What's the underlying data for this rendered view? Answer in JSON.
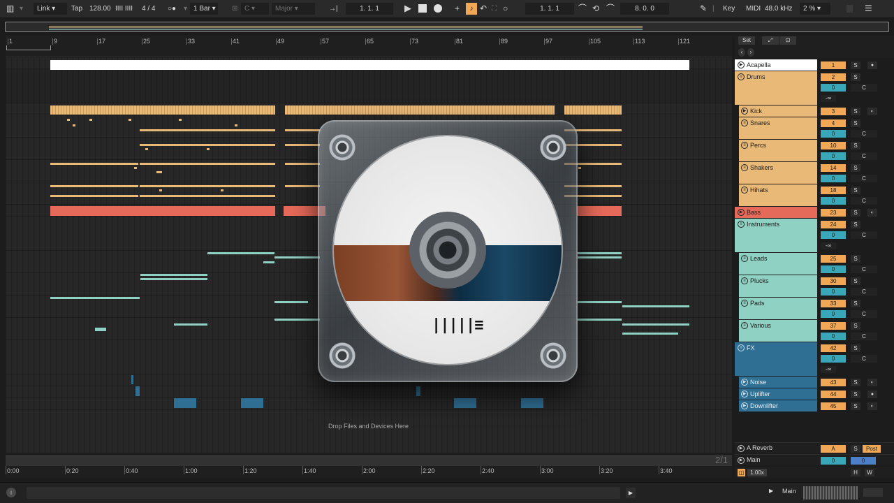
{
  "transport": {
    "link_label": "Link",
    "tap_label": "Tap",
    "tempo": "128.00",
    "meter_icon": "IIII IIII",
    "time_signature": "4 / 4",
    "metronome": "○●",
    "quantize": "1 Bar",
    "key_root": "C",
    "scale": "Major",
    "position": "1.   1.   1",
    "loop_start": "1.   1.   1",
    "loop_length": "8.   0.   0",
    "key_label": "Key",
    "midi_label": "MIDI",
    "sample_rate": "48.0 kHz",
    "cpu": "2 %"
  },
  "ruler": {
    "bars": [
      "1",
      "9",
      "17",
      "25",
      "33",
      "41",
      "49",
      "57",
      "65",
      "73",
      "81",
      "89",
      "97",
      "105",
      "113",
      "121"
    ]
  },
  "time_ruler": {
    "times": [
      "0:00",
      "0:20",
      "0:40",
      "1:00",
      "1:20",
      "1:40",
      "2:00",
      "2:20",
      "2:40",
      "3:00",
      "3:20",
      "3:40"
    ],
    "bars_ratio": "2/1"
  },
  "arrangement": {
    "drop_text": "Drop Files and Devices Here"
  },
  "mixer_top": {
    "set_label": "Set",
    "expand_icon": "⤢",
    "lock_icon": "🔒"
  },
  "tracks": [
    {
      "name": "Acapella",
      "num": "1"
    },
    {
      "name": "Drums",
      "num": "2",
      "vol": "0",
      "pan": "C",
      "send": "-∞"
    },
    {
      "name": "Kick",
      "num": "3"
    },
    {
      "name": "Snares",
      "num": "4",
      "vol": "0",
      "pan": "C"
    },
    {
      "name": "Percs",
      "num": "10",
      "vol": "0",
      "pan": "C"
    },
    {
      "name": "Shakers",
      "num": "14",
      "vol": "0",
      "pan": "C"
    },
    {
      "name": "Hihats",
      "num": "18",
      "vol": "0",
      "pan": "C"
    },
    {
      "name": "Bass",
      "num": "23"
    },
    {
      "name": "Instruments",
      "num": "24",
      "vol": "0",
      "pan": "C",
      "send": "-∞"
    },
    {
      "name": "Leads",
      "num": "25",
      "vol": "0",
      "pan": "C"
    },
    {
      "name": "Plucks",
      "num": "30",
      "vol": "0",
      "pan": "C"
    },
    {
      "name": "Pads",
      "num": "33",
      "vol": "0",
      "pan": "C"
    },
    {
      "name": "Various",
      "num": "37",
      "vol": "0",
      "pan": "C"
    },
    {
      "name": "FX",
      "num": "42",
      "vol": "0",
      "pan": "C",
      "send": "-∞"
    },
    {
      "name": "Noise",
      "num": "43"
    },
    {
      "name": "Uplifter",
      "num": "44"
    },
    {
      "name": "Downlifter",
      "num": "45"
    }
  ],
  "solo_label": "S",
  "returns": {
    "reverb_name": "A Reverb",
    "reverb_letter": "A",
    "post_label": "Post",
    "main_name": "Main",
    "main_vol": "0",
    "main_pan": "0",
    "h_label": "H",
    "w_label": "W",
    "zoom": "1.00x"
  },
  "statusbar": {
    "main_label": "Main"
  },
  "colors": {
    "drums": "#e9b978",
    "bass": "#e66a5a",
    "instruments": "#8fd1c3",
    "fx": "#2f6f94",
    "acapella": "#ffffff"
  }
}
